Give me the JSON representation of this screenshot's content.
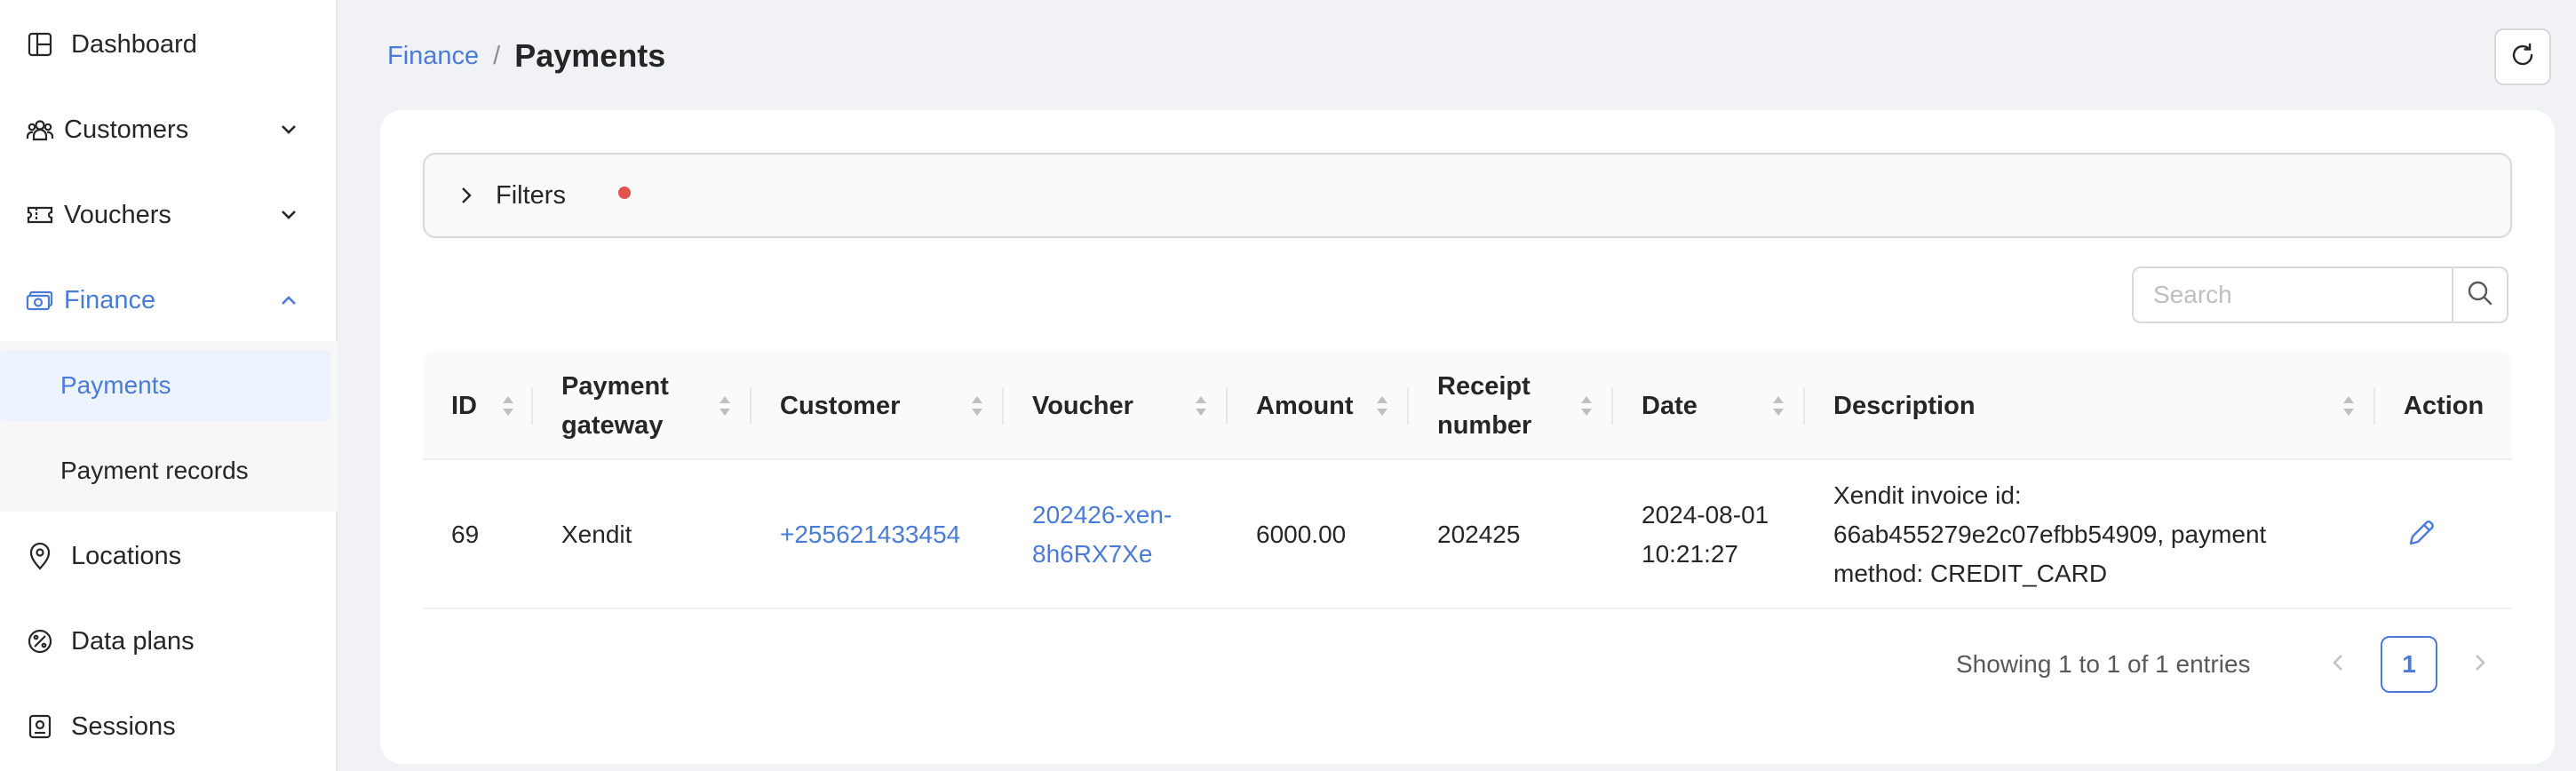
{
  "colors": {
    "accent": "#4a7bd6",
    "badge": "#e25450",
    "background": "#f0f2f5"
  },
  "sidebar": {
    "items": [
      {
        "label": "Dashboard",
        "icon": "dashboard-icon"
      },
      {
        "label": "Customers",
        "icon": "users-icon",
        "expandable": true
      },
      {
        "label": "Vouchers",
        "icon": "ticket-icon",
        "expandable": true
      },
      {
        "label": "Finance",
        "icon": "money-icon",
        "expanded": true,
        "active": true,
        "children": [
          {
            "label": "Payments",
            "selected": true
          },
          {
            "label": "Payment records"
          }
        ]
      },
      {
        "label": "Locations",
        "icon": "location-pin-icon"
      },
      {
        "label": "Data plans",
        "icon": "percent-icon"
      },
      {
        "label": "Sessions",
        "icon": "session-icon"
      }
    ]
  },
  "header": {
    "breadcrumb_parent": "Finance",
    "breadcrumb_separator": "/",
    "title": "Payments"
  },
  "filters": {
    "label": "Filters",
    "active_indicator": true
  },
  "search": {
    "placeholder": "Search",
    "value": ""
  },
  "table": {
    "columns": [
      "ID",
      "Payment gateway",
      "Customer",
      "Voucher",
      "Amount",
      "Receipt number",
      "Date",
      "Description",
      "Action"
    ],
    "rows": [
      {
        "id": "69",
        "gateway": "Xendit",
        "customer": "+255621433454",
        "voucher": "202426-xen-8h6RX7Xe",
        "amount": "6000.00",
        "receipt": "202425",
        "date": "2024-08-01 10:21:27",
        "description": "Xendit invoice id: 66ab455279e2c07efbb54909, payment method: CREDIT_CARD"
      }
    ]
  },
  "pagination": {
    "info": "Showing 1 to 1 of 1 entries",
    "current_page": "1"
  }
}
